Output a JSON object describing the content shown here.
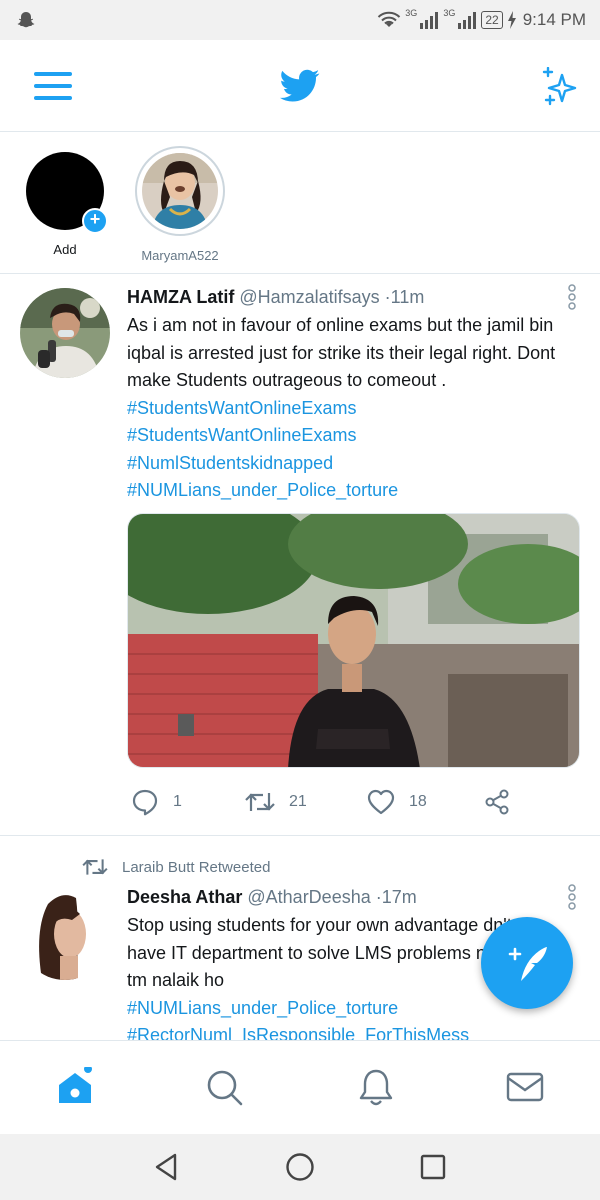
{
  "status_bar": {
    "network_1": "3G",
    "network_2": "3G",
    "battery": "22",
    "time": "9:14 PM"
  },
  "top_bar": {
    "menu_icon": "hamburger-menu-icon",
    "logo_icon": "twitter-bird-icon",
    "sparkle_icon": "sparkle-icon"
  },
  "fleets": [
    {
      "label": "Add"
    },
    {
      "label": "MaryamA522"
    }
  ],
  "tweets": [
    {
      "name": "HAMZA Latif",
      "handle": "@Hamzalatifsays",
      "separator": "·",
      "time": "11m",
      "text": "As i am not in favour of online exams but the jamil bin iqbal is arrested just for strike its their legal right. Dont make Students outrageous to comeout .",
      "hashtags": [
        "#StudentsWantOnlineExams",
        "#StudentsWantOnlineExams",
        "#NumlStudentskidnapped",
        "#NUMLians_under_Police_torture"
      ],
      "replies": "1",
      "retweets": "21",
      "likes": "18"
    },
    {
      "retweeted_by": "Laraib Butt Retweeted",
      "name": "Deesha Athar",
      "handle": "@AtharDeesha",
      "separator": "·",
      "time": "17m",
      "text": "Stop using students for your own advantage dn't you have IT department to solve LMS problems nalaik nahi tm nalaik ho",
      "hashtags": [
        "#NUMLians_under_Police_torture",
        "#RectorNuml_IsResponsible_ForThisMess"
      ]
    }
  ],
  "colors": {
    "accent": "#1da1f2",
    "link": "#1b95e0",
    "muted": "#657786",
    "divider": "#e1e8ed"
  }
}
